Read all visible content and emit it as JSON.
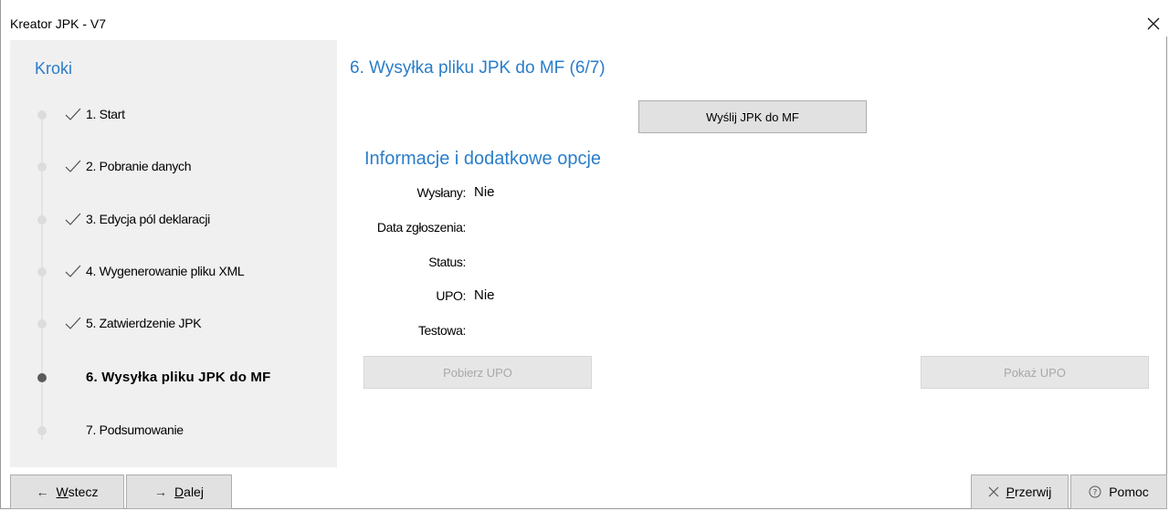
{
  "window": {
    "title": "Kreator JPK - V7"
  },
  "sidebar": {
    "title": "Kroki",
    "steps": [
      {
        "label": "1. Start",
        "done": true
      },
      {
        "label": "2. Pobranie danych",
        "done": true
      },
      {
        "label": "3. Edycja pól deklaracji",
        "done": true
      },
      {
        "label": "4. Wygenerowanie pliku XML",
        "done": true
      },
      {
        "label": "5. Zatwierdzenie JPK",
        "done": true
      },
      {
        "label": "6. Wysyłka pliku JPK do MF",
        "done": false,
        "active": true
      },
      {
        "label": "7. Podsumowanie",
        "done": false
      }
    ]
  },
  "main": {
    "title": "6. Wysyłka pliku JPK do MF (6/7)",
    "send_button": "Wyślij JPK do MF",
    "info_title": "Informacje i dodatkowe opcje",
    "fields": {
      "sent_label": "Wysłany:",
      "sent_value": "Nie",
      "date_label": "Data zgłoszenia:",
      "status_label": "Status:",
      "upo_label": "UPO:",
      "upo_value": "Nie",
      "test_label": "Testowa:"
    },
    "fetch_upo_button": "Pobierz UPO",
    "show_upo_button": "Pokaż UPO"
  },
  "footer": {
    "back_prefix": "",
    "back_hotkey": "W",
    "back_rest": "stecz",
    "next_hotkey": "D",
    "next_rest": "alej",
    "abort_hotkey": "P",
    "abort_rest": "rzerwij",
    "help_label": "Pomoc"
  },
  "icons": {
    "close": "close-icon",
    "check": "checkmark-icon",
    "back": "arrow-left-icon",
    "next": "arrow-right-icon",
    "abort": "x-icon",
    "help": "question-circle-icon"
  },
  "colors": {
    "accent": "#2a7dc9",
    "sidebar_bg": "#f0f0f0"
  }
}
